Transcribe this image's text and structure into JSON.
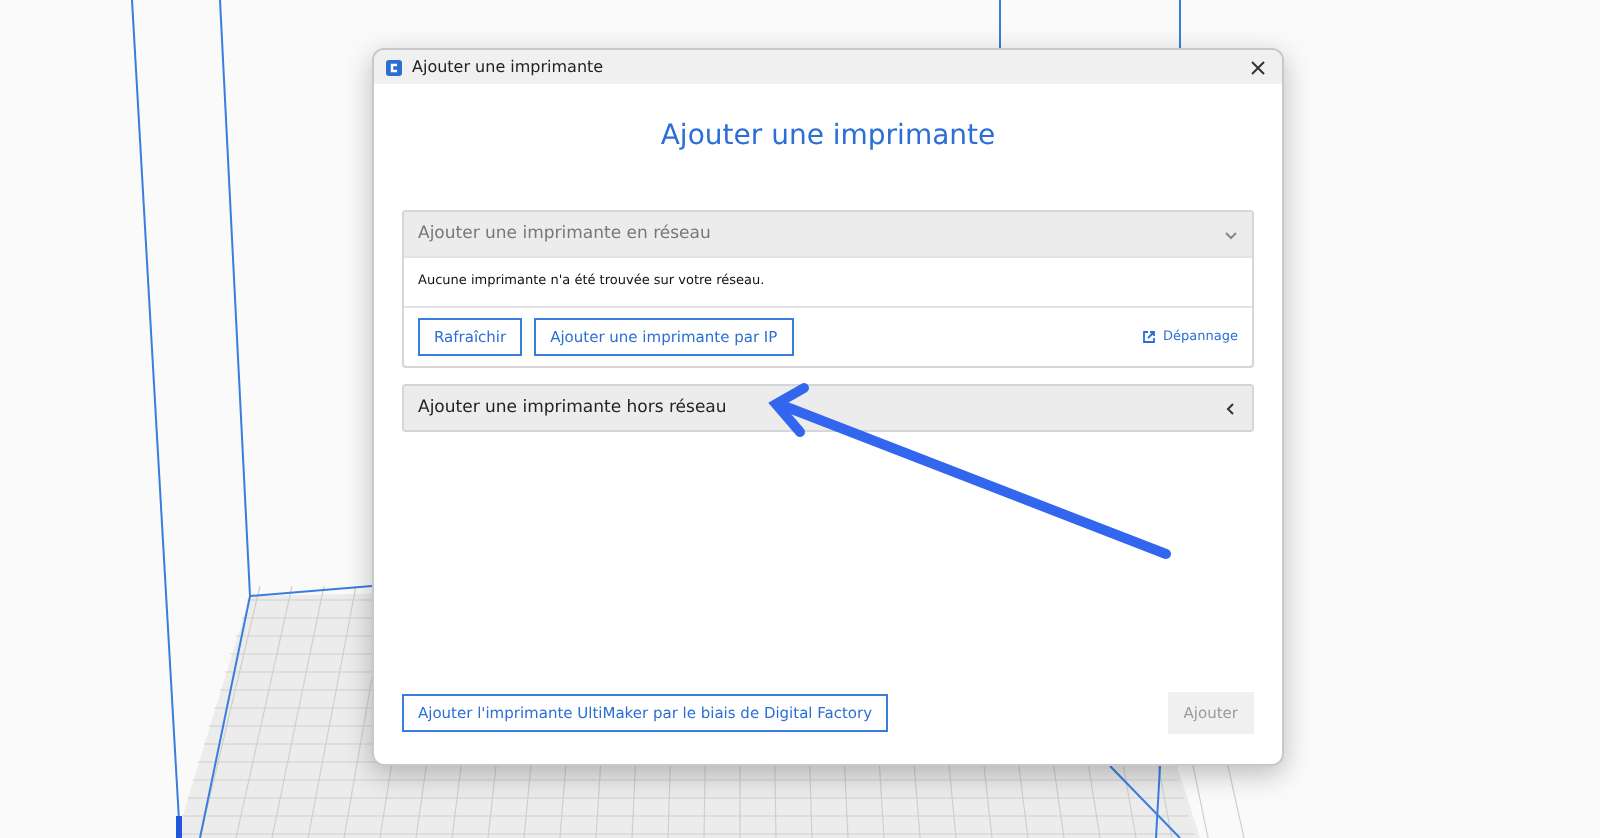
{
  "window": {
    "title": "Ajouter une imprimante"
  },
  "heading": "Ajouter une imprimante",
  "sections": [
    {
      "title": "Ajouter une imprimante en réseau",
      "expanded": true,
      "message": "Aucune imprimante n'a été trouvée sur votre réseau.",
      "buttons": [
        "Rafraîchir",
        "Ajouter une imprimante par IP"
      ],
      "link": "Dépannage"
    },
    {
      "title": "Ajouter une imprimante hors réseau",
      "expanded": false
    }
  ],
  "footer": {
    "cloud_button": "Ajouter l'imprimante UltiMaker par le biais de Digital Factory",
    "add_button": {
      "label": "Ajouter",
      "disabled": true
    }
  }
}
